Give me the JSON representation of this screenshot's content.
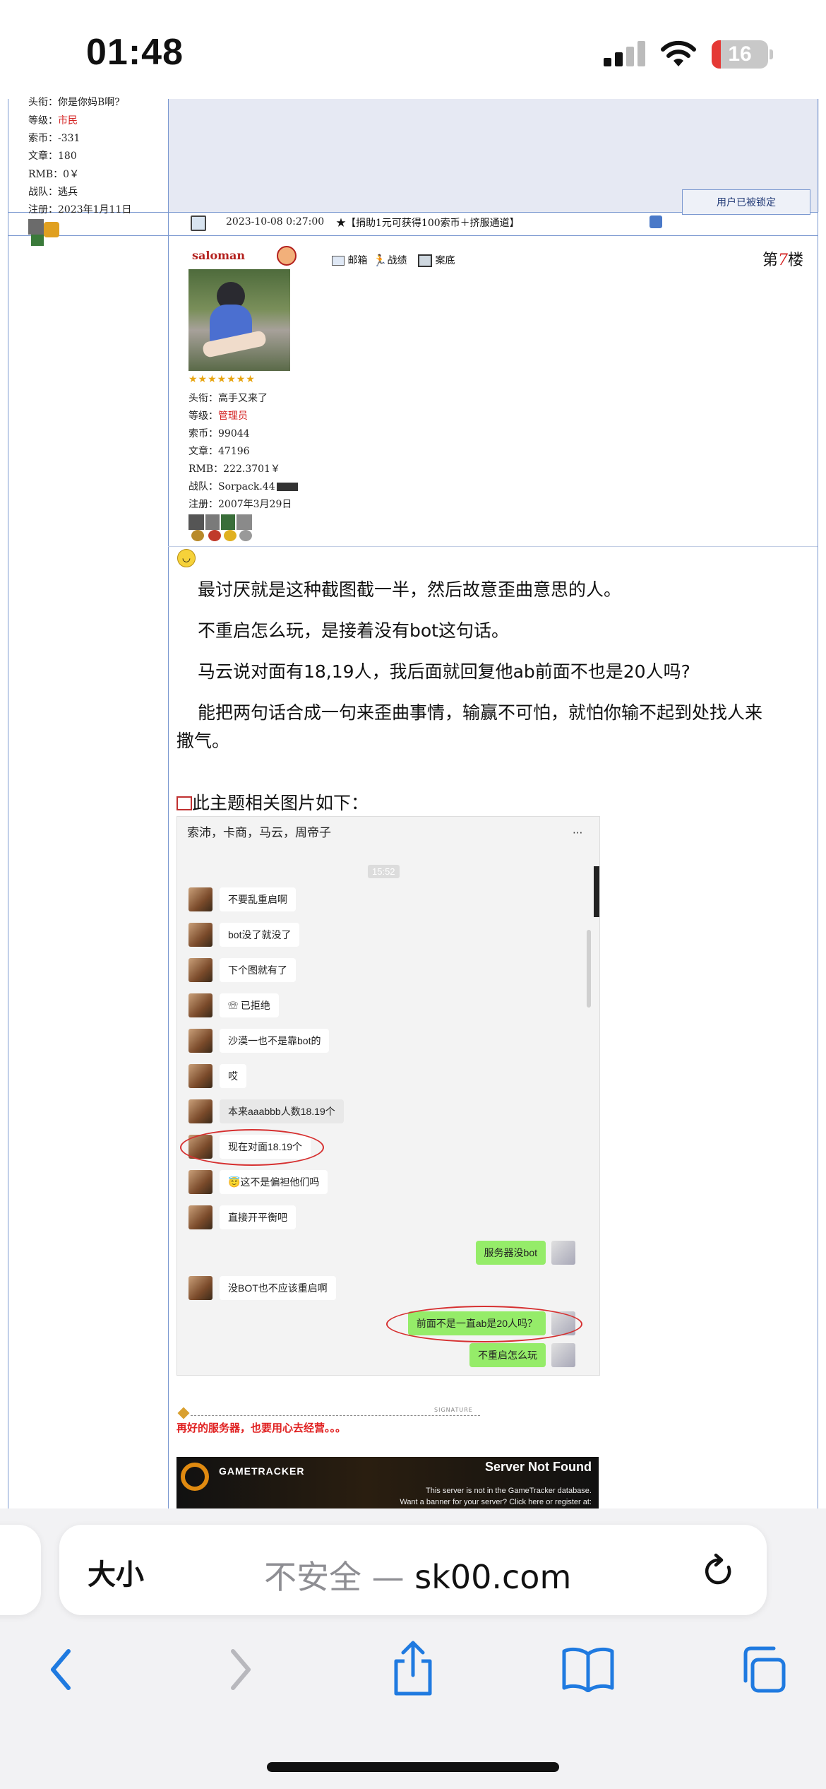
{
  "status_bar": {
    "time": "01:48",
    "battery_level": "16"
  },
  "prev_post": {
    "title_label": "头衔：",
    "title_value": "你是你妈B啊?",
    "level_label": "等级：",
    "level_value": "市民",
    "coins": "索币：-331",
    "articles": "文章：180",
    "rmb": "RMB：0￥",
    "team": "战队：逃兵",
    "registered": "注册：2023年1月11日",
    "locked_label": "用户已被锁定"
  },
  "post_header": {
    "date": "2023-10-08 0:27:00",
    "promo": "★【捐助1元可获得100索币＋挤服通道】"
  },
  "author": {
    "name": "saloman",
    "title": "头衔：高手又来了",
    "level_label": "等级：",
    "level_value": "管理员",
    "coins": "索币：99044",
    "articles": "文章：47196",
    "rmb": "RMB：222.3701￥",
    "team": "战队：Sorpack.44",
    "registered": "注册：2007年3月29日",
    "actions": [
      "邮箱",
      "战绩",
      "案底"
    ]
  },
  "floor": {
    "prefix": "第",
    "number": "7",
    "suffix": "楼"
  },
  "post_body": {
    "para1": "最讨厌就是这种截图截一半，然后故意歪曲意思的人。",
    "para2": "不重启怎么玩，是接着没有bot这句话。",
    "para3": "马云说对面有18,19人，我后面就回复他ab前面不也是20人吗?",
    "para4_line1": "能把两句话合成一句来歪曲事情，输赢不可怕，就怕你输不起到处找人来",
    "para4_line2": "撒气。",
    "attachment_label": "此主题相关图片如下："
  },
  "chat": {
    "group_title": "索沛，卡商，马云，周帝子",
    "more": "···",
    "time": "15:52",
    "messages": [
      {
        "text": "不要乱重启啊",
        "mine": false
      },
      {
        "text": "bot没了就没了",
        "mine": false
      },
      {
        "text": "下个图就有了",
        "mine": false
      },
      {
        "text": "☏ 已拒绝",
        "mine": false
      },
      {
        "text": "沙漠一也不是靠bot的",
        "mine": false
      },
      {
        "text": "哎",
        "mine": false
      },
      {
        "text": "本来aaabbb人数18.19个",
        "mine": false
      },
      {
        "text": "现在对面18.19个",
        "mine": false
      },
      {
        "text": "😇这不是偏袒他们吗",
        "mine": false
      },
      {
        "text": "直接开平衡吧",
        "mine": false
      },
      {
        "text": "服务器没bot",
        "mine": true
      },
      {
        "text": "没BOT也不应该重启啊",
        "mine": false
      },
      {
        "text": "前面不是一直ab是20人吗？",
        "mine": true
      },
      {
        "text": "不重启怎么玩",
        "mine": true
      }
    ]
  },
  "signature": {
    "label": "SIGNATURE",
    "text": "再好的服务器，也要用心去经营。。。",
    "banner_brand": "GAMETRACKER",
    "banner_title": "Server Not Found",
    "banner_line1": "This server is not in the GameTracker database.",
    "banner_line2": "Want a banner for your server? Click here or register at:"
  },
  "safari": {
    "text_size": "大小",
    "url_prefix": "不安全 — ",
    "url": "sk00.com"
  }
}
